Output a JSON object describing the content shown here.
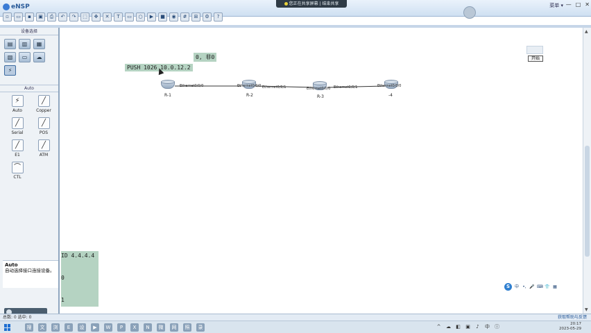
{
  "app": {
    "title": "eNSP",
    "share_bar_text": "您正在共享屏幕 | 结束共享",
    "menu_right": "菜单 ▾",
    "window_controls": [
      "—",
      "□",
      "✕"
    ]
  },
  "toolbar": {
    "icons": [
      "new-file-icon",
      "open-icon",
      "save-icon",
      "save-as-icon",
      "print-icon",
      "undo-icon",
      "redo-icon",
      "select-icon",
      "pan-icon",
      "delete-icon",
      "text-icon",
      "rect-icon",
      "ellipse-icon",
      "start-device-icon",
      "stop-device-icon",
      "capture-icon",
      "grid-icon",
      "topology-icon",
      "settings-icon",
      "help-icon"
    ],
    "glyphs": [
      "▫",
      "▭",
      "▪",
      "▣",
      "⎙",
      "↶",
      "↷",
      "⬚",
      "✥",
      "✕",
      "T",
      "▭",
      "○",
      "▶",
      "■",
      "◉",
      "#",
      "⊞",
      "⚙",
      "?"
    ]
  },
  "left_panel": {
    "section_title": "设备选择",
    "devices": [
      {
        "name": "router-category",
        "glyph": "▤",
        "selected": false
      },
      {
        "name": "switch-category",
        "glyph": "▥",
        "selected": false
      },
      {
        "name": "wlan-category",
        "glyph": "▦",
        "selected": false
      },
      {
        "name": "firewall-category",
        "glyph": "▧",
        "selected": false
      },
      {
        "name": "pc-category",
        "glyph": "▭",
        "selected": false
      },
      {
        "name": "cloud-category",
        "glyph": "☁",
        "selected": false
      },
      {
        "name": "cable-category",
        "glyph": "⚡",
        "selected": true
      }
    ],
    "subsection_title": "Auto",
    "cables": [
      {
        "label": "Auto",
        "glyph": "⚡"
      },
      {
        "label": "Copper",
        "glyph": "╱"
      },
      {
        "label": "Serial",
        "glyph": "╱"
      },
      {
        "label": "POS",
        "glyph": "╱"
      },
      {
        "label": "E1",
        "glyph": "╱"
      },
      {
        "label": "ATM",
        "glyph": "╱"
      },
      {
        "label": "CTL",
        "glyph": "⌒"
      }
    ],
    "description": {
      "title": "Auto",
      "text": "自动选择接口连接设备。"
    }
  },
  "workspace": {
    "overlay_line1": "0, 非0",
    "overlay_line2": "PUSH 1026 10.0.12.2",
    "routers": [
      {
        "label": "R-1"
      },
      {
        "label": "R-2"
      },
      {
        "label": "R-3"
      },
      {
        "label": "-4"
      }
    ],
    "port_labels": [
      "Ethernet0/0/0",
      "Ethernet0/0/0",
      "Ethernet0/0/1",
      "Ethernet0/0/0",
      "Ethernet0/0/1",
      "Ethernet0/0/0"
    ],
    "start_button": "开始"
  },
  "terminal": {
    "line1": "ID 4.4.4.4",
    "line2": "0",
    "line3": "1"
  },
  "ime": {
    "logo": "S",
    "items": [
      "中",
      "•,",
      "🎤",
      "⌨",
      "👕",
      "▦"
    ]
  },
  "statusbar": {
    "left": "总数: 0  选中: 0",
    "right": "获取帮助与反馈"
  },
  "taskbar": {
    "icons": [
      "搜",
      "文",
      "浏",
      "E",
      "设",
      "▶",
      "W",
      "P",
      "X",
      "N",
      "微",
      "网",
      "照",
      "录"
    ],
    "tray": [
      "^",
      "☁",
      "◧",
      "▣",
      "♪",
      "中",
      "ⓘ"
    ],
    "clock_time": "20:17",
    "clock_date": "2023-05-29"
  },
  "colors": {
    "overlay_green": "#b5d3c2",
    "accent_blue": "#2b5c9a"
  }
}
